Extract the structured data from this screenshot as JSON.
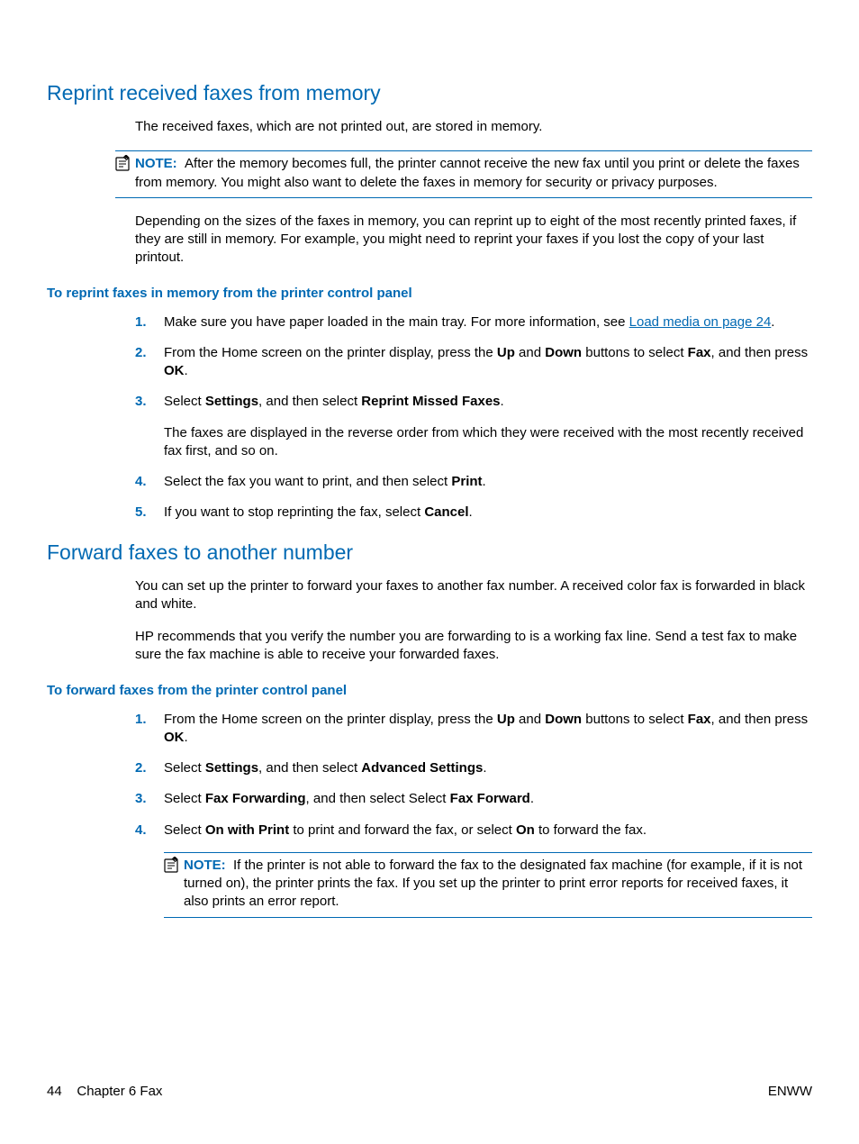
{
  "section1": {
    "heading": "Reprint received faxes from memory",
    "intro": "The received faxes, which are not printed out, are stored in memory.",
    "note_label": "NOTE:",
    "note_text": "After the memory becomes full, the printer cannot receive the new fax until you print or delete the faxes from memory. You might also want to delete the faxes in memory for security or privacy purposes.",
    "para2": "Depending on the sizes of the faxes in memory, you can reprint up to eight of the most recently printed faxes, if they are still in memory. For example, you might need to reprint your faxes if you lost the copy of your last printout.",
    "sub1": "To reprint faxes in memory from the printer control panel",
    "steps": {
      "s1_a": "Make sure you have paper loaded in the main tray. For more information, see ",
      "s1_link": "Load media on page 24",
      "s1_b": ".",
      "s2_a": "From the Home screen on the printer display, press the ",
      "s2_up": "Up",
      "s2_b": " and ",
      "s2_down": "Down",
      "s2_c": " buttons to select ",
      "s2_fax": "Fax",
      "s2_d": ", and then press ",
      "s2_ok": "OK",
      "s2_e": ".",
      "s3_a": "Select ",
      "s3_settings": "Settings",
      "s3_b": ", and then select ",
      "s3_reprint": "Reprint Missed Faxes",
      "s3_c": ".",
      "s3_p": "The faxes are displayed in the reverse order from which they were received with the most recently received fax first, and so on.",
      "s4_a": "Select the fax you want to print, and then select ",
      "s4_print": "Print",
      "s4_b": ".",
      "s5_a": "If you want to stop reprinting the fax, select ",
      "s5_cancel": "Cancel",
      "s5_b": "."
    }
  },
  "section2": {
    "heading": "Forward faxes to another number",
    "intro": "You can set up the printer to forward your faxes to another fax number. A received color fax is forwarded in black and white.",
    "para2": "HP recommends that you verify the number you are forwarding to is a working fax line. Send a test fax to make sure the fax machine is able to receive your forwarded faxes.",
    "sub1": "To forward faxes from the printer control panel",
    "steps": {
      "s1_a": "From the Home screen on the printer display, press the ",
      "s1_up": "Up",
      "s1_b": " and ",
      "s1_down": "Down",
      "s1_c": " buttons to select ",
      "s1_fax": "Fax",
      "s1_d": ", and then press ",
      "s1_ok": "OK",
      "s1_e": ".",
      "s2_a": "Select ",
      "s2_settings": "Settings",
      "s2_b": ", and then select ",
      "s2_adv": "Advanced Settings",
      "s2_c": ".",
      "s3_a": "Select ",
      "s3_ff": "Fax Forwarding",
      "s3_b": ", and then select Select ",
      "s3_fw": "Fax Forward",
      "s3_c": ".",
      "s4_a": "Select ",
      "s4_owp": "On with Print",
      "s4_b": " to print and forward the fax, or select ",
      "s4_on": "On",
      "s4_c": " to forward the fax.",
      "note_label": "NOTE:",
      "note_text": "If the printer is not able to forward the fax to the designated fax machine (for example, if it is not turned on), the printer prints the fax. If you set up the printer to print error reports for received faxes, it also prints an error report."
    }
  },
  "footer": {
    "page_num": "44",
    "chapter": "Chapter 6   Fax",
    "right": "ENWW"
  }
}
